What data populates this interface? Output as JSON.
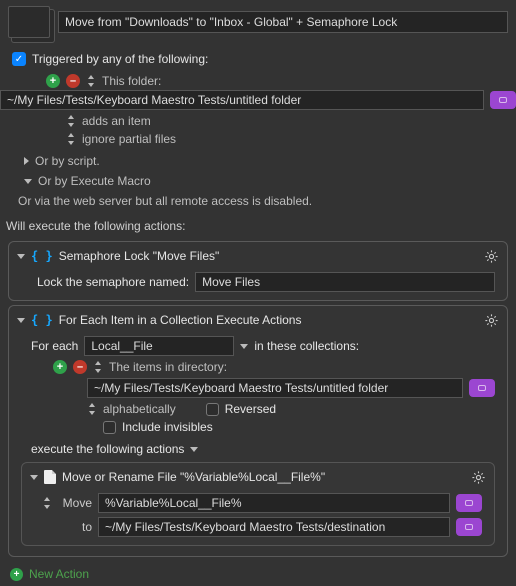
{
  "header": {
    "macro_name": "Move from \"Downloads\" to \"Inbox - Global\" + Semaphore Lock"
  },
  "trigger": {
    "checked_label": "Triggered by any of the following:",
    "this_folder_label": "This folder:",
    "folder_path": "~/My Files/Tests/Keyboard Maestro Tests/untitled folder",
    "adds_label": "adds an item",
    "ignore_label": "ignore partial files",
    "by_script_label": "Or by script.",
    "by_macro_label": "Or by Execute Macro",
    "web_label": "Or via the web server but all remote access is disabled."
  },
  "execute_header": "Will execute the following actions:",
  "semaphore": {
    "title": "Semaphore Lock \"Move Files\"",
    "row_label": "Lock the semaphore named:",
    "value": "Move Files"
  },
  "foreach": {
    "title": "For Each Item in a Collection Execute Actions",
    "for_each_label": "For each",
    "var_name": "Local__File",
    "collections_label": "in these collections:",
    "items_label": "The items in directory:",
    "dir_path": "~/My Files/Tests/Keyboard Maestro Tests/untitled folder",
    "sort_label": "alphabetically",
    "reversed_label": "Reversed",
    "invisibles_label": "Include invisibles",
    "exec_label": "execute the following actions"
  },
  "move": {
    "title": "Move or Rename File \"%Variable%Local__File%\"",
    "move_label": "Move",
    "src": "%Variable%Local__File%",
    "to_label": "to",
    "dst": "~/My Files/Tests/Keyboard Maestro Tests/destination"
  },
  "new_action_label": "New Action"
}
